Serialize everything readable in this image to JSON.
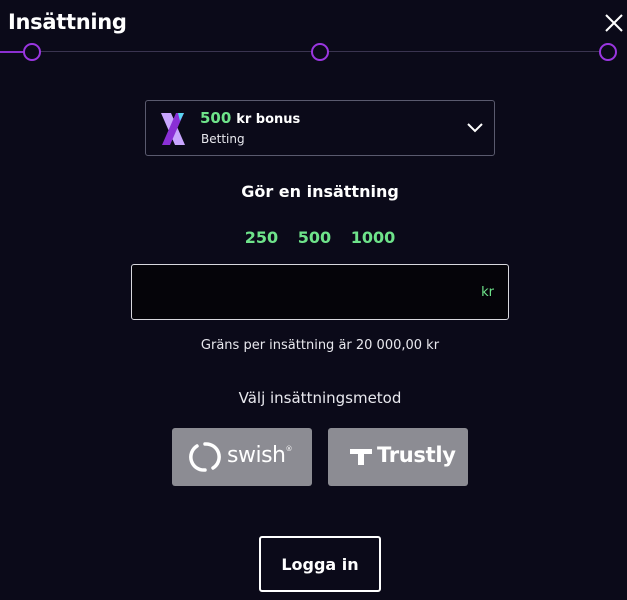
{
  "header": {
    "title": "Insättning",
    "close_icon": "close-icon"
  },
  "stepper": {
    "steps": 3,
    "active_step": 1,
    "accent_color": "#9a36e0"
  },
  "bonus": {
    "amount": "500",
    "label": "kr bonus",
    "category": "Betting",
    "logo_icon": "brand-x-icon",
    "dropdown_icon": "chevron-down-icon"
  },
  "deposit": {
    "heading": "Gör en insättning",
    "presets": [
      "250",
      "500",
      "1000"
    ],
    "amount_value": "",
    "currency": "kr",
    "limit_text": "Gräns per insättning är 20 000,00 kr"
  },
  "methods": {
    "heading": "Välj insättningsmetod",
    "items": [
      {
        "name": "swish",
        "label": "swish",
        "icon": "swish-logo-icon"
      },
      {
        "name": "trustly",
        "label": "Trustly",
        "icon": "trustly-logo-icon"
      }
    ]
  },
  "login": {
    "label": "Logga in"
  },
  "colors": {
    "background": "#0b0a19",
    "accent_green": "#6ee38a",
    "accent_purple": "#9a36e0",
    "method_button": "#8c8c93"
  }
}
